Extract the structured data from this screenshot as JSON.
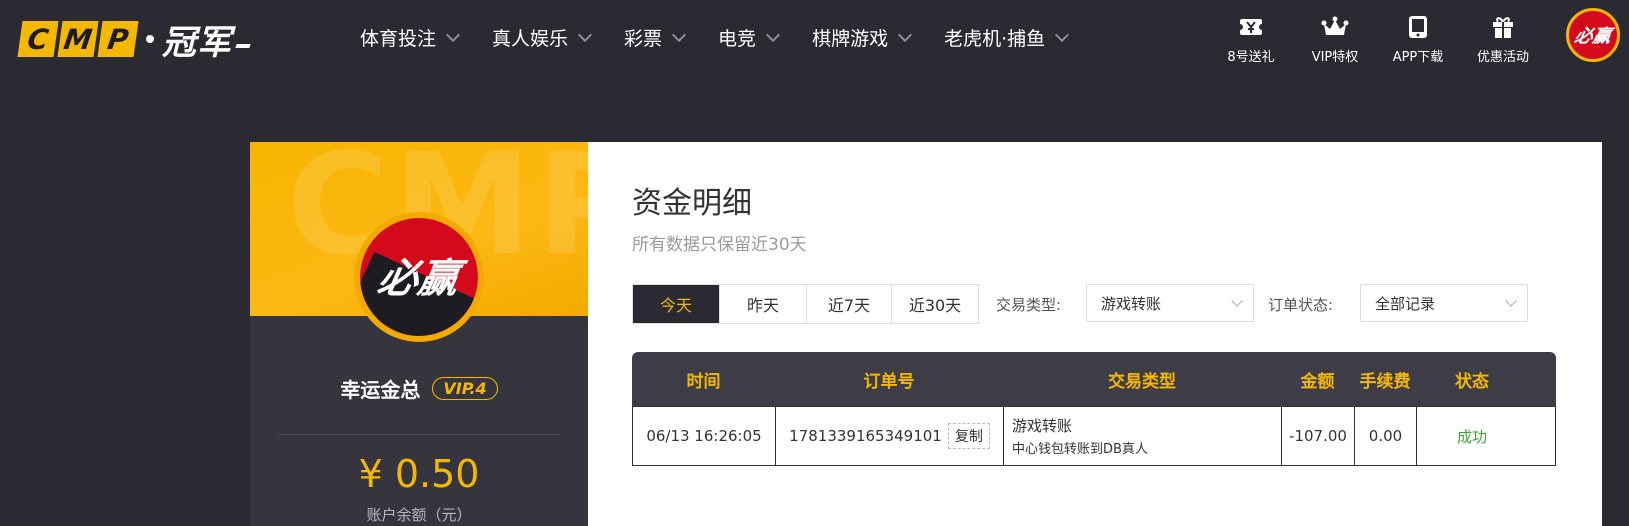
{
  "brand": {
    "tiles": [
      "C",
      "M",
      "P"
    ],
    "name": "冠军"
  },
  "nav": [
    {
      "label": "体育投注"
    },
    {
      "label": "真人娱乐"
    },
    {
      "label": "彩票"
    },
    {
      "label": "电竞"
    },
    {
      "label": "棋牌游戏"
    },
    {
      "label": "老虎机·捕鱼"
    }
  ],
  "quick_links": [
    {
      "label": "8号送礼",
      "icon": "gift-ticket-icon"
    },
    {
      "label": "VIP特权",
      "icon": "crown-icon"
    },
    {
      "label": "APP下载",
      "icon": "phone-icon"
    },
    {
      "label": "优惠活动",
      "icon": "gift-box-icon"
    }
  ],
  "avatar_text": "必赢",
  "profile": {
    "watermark": "CMP",
    "username": "幸运金总",
    "vip": "VIP.4",
    "balance": "¥ 0.50",
    "balance_label": "账户余额（元）"
  },
  "page": {
    "title": "资金明细",
    "subtitle": "所有数据只保留近30天"
  },
  "filters": {
    "ranges": [
      "今天",
      "昨天",
      "近7天",
      "近30天"
    ],
    "active_range": "今天",
    "type_label": "交易类型:",
    "type_value": "游戏转账",
    "status_label": "订单状态:",
    "status_value": "全部记录"
  },
  "table": {
    "headers": [
      "时间",
      "订单号",
      "交易类型",
      "金额",
      "手续费",
      "状态"
    ],
    "rows": [
      {
        "time": "06/13 16:26:05",
        "order_no": "1781339165349101",
        "copy": "复制",
        "type_main": "游戏转账",
        "type_sub": "中心钱包转账到DB真人",
        "amount": "-107.00",
        "fee": "0.00",
        "status": "成功"
      }
    ]
  },
  "colors": {
    "accent": "#f5b800",
    "dark": "#2b2a33",
    "success": "#3aa437",
    "brand_red": "#d4091b"
  }
}
